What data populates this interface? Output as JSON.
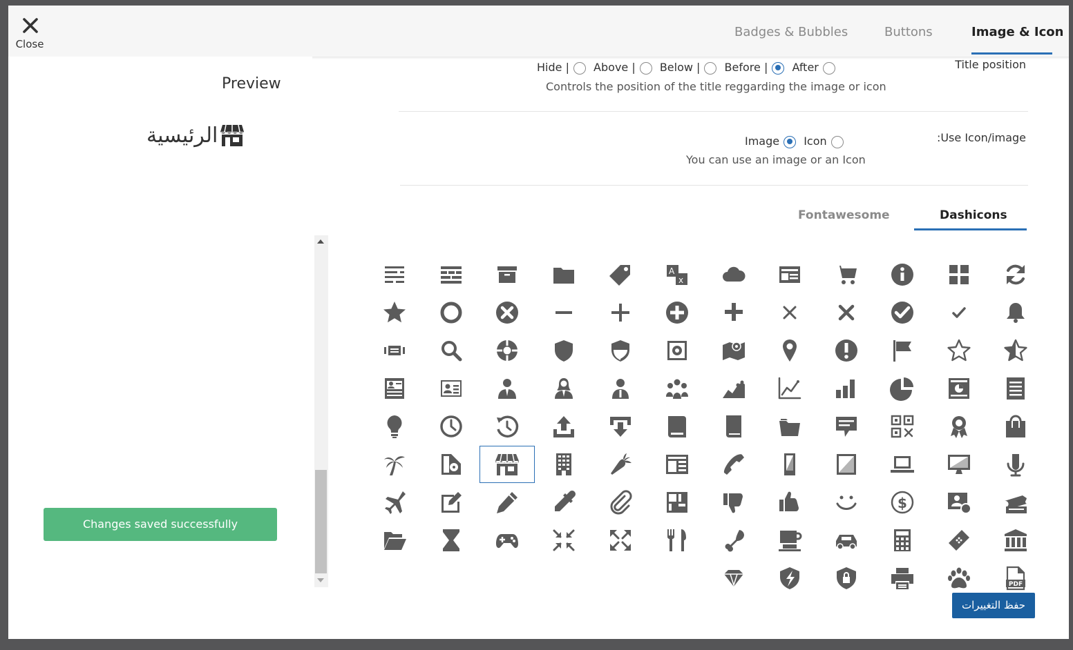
{
  "header": {
    "close_label": "Close",
    "tabs": [
      {
        "label": "Badges & Bubbles",
        "active": false
      },
      {
        "label": "Buttons",
        "active": false
      },
      {
        "label": "Image & Icon",
        "active": true
      }
    ]
  },
  "preview": {
    "title": "Preview",
    "label": "الرئيسية",
    "icon": "store-icon"
  },
  "toast": "Changes saved successfully",
  "title_position": {
    "label": "Title position",
    "options": [
      "Hide |",
      "Above |",
      "Below |",
      "Before |",
      "After"
    ],
    "selected": "Before |",
    "help": "Controls the position of the title reggarding the image or icon"
  },
  "use_icon": {
    "label": ":Use Icon/image",
    "options": [
      "Image",
      "Icon"
    ],
    "selected": "Icon",
    "help": "You can use an image or an Icon"
  },
  "icon_tabs": [
    {
      "label": "Fontawesome",
      "active": false
    },
    {
      "label": "Dashicons",
      "active": true
    }
  ],
  "icons": [
    [
      "partial",
      "partial",
      "partial",
      "partial",
      "partial",
      "partial",
      "partial",
      "partial",
      "partial",
      "partial",
      "partial",
      "partial"
    ],
    [
      "text-align-icon",
      "columns-icon",
      "archive-icon",
      "folder-icon",
      "tag-icon",
      "translation-icon",
      "cloud-icon",
      "id-card-icon",
      "cart-icon",
      "info-icon",
      "grid-view-icon",
      "update-icon"
    ],
    [
      "star-filled-icon",
      "marker-icon",
      "dismiss-icon",
      "minus-icon",
      "plus-icon",
      "plus-circle-icon",
      "plus-bold-icon",
      "no-alt-icon",
      "no-icon",
      "yes-circle-icon",
      "yes-icon",
      "bell-icon"
    ],
    [
      "slides-icon",
      "search-icon",
      "sos-icon",
      "shield-icon",
      "shield-alt-icon",
      "vault-icon",
      "location-map-icon",
      "location-icon",
      "warning-icon",
      "flag-icon",
      "star-empty-icon",
      "star-half-icon"
    ],
    [
      "id-alt-icon",
      "businessman-card-icon",
      "businessman-icon",
      "businesswoman-icon",
      "businessperson-icon",
      "groups-icon",
      "chart-area-icon",
      "chart-line-icon",
      "chart-bar-icon",
      "chart-pie-icon",
      "analytics-icon",
      "list-view-icon"
    ],
    [
      "lightbulb-icon",
      "clock-icon",
      "backup-icon",
      "upload-icon",
      "download-icon",
      "book-icon",
      "book-alt-icon",
      "portfolio-icon",
      "testimonial-icon",
      "qr-icon",
      "awards-icon",
      "products-icon"
    ],
    [
      "palmtree-icon",
      "media-icon",
      "store-icon",
      "building-icon",
      "carrot-icon",
      "index-card-icon",
      "phone-icon",
      "smartphone-icon",
      "tablet-icon",
      "laptop-icon",
      "desktop-icon",
      "microphone-icon"
    ],
    [
      "airplane-icon",
      "edit-page-icon",
      "pencil-icon",
      "eyedropper-icon",
      "paperclip-icon",
      "layout-icon",
      "thumbs-down-icon",
      "thumbs-up-icon",
      "smiley-icon",
      "money-icon",
      "admin-users-icon",
      "tickets-icon"
    ],
    [
      "folder-open-icon",
      "hourglass-icon",
      "gamepad-icon",
      "shrink-icon",
      "expand-icon",
      "food-icon",
      "drumstick-icon",
      "coffee-icon",
      "car-icon",
      "calculator-icon",
      "bandage-icon",
      "bank-icon"
    ],
    [
      "",
      "",
      "",
      "",
      "",
      "",
      "diamond-icon",
      "superhero-icon",
      "privacy-icon",
      "printer-icon",
      "pets-icon",
      "pdf-icon"
    ]
  ],
  "selected_icon": "store-icon",
  "save_label": "حفظ التغييرات",
  "colors": {
    "accent": "#2a6fb5",
    "save_button": "#1a5fa0",
    "toast": "#55b87f",
    "icon": "#5b5b5b"
  }
}
